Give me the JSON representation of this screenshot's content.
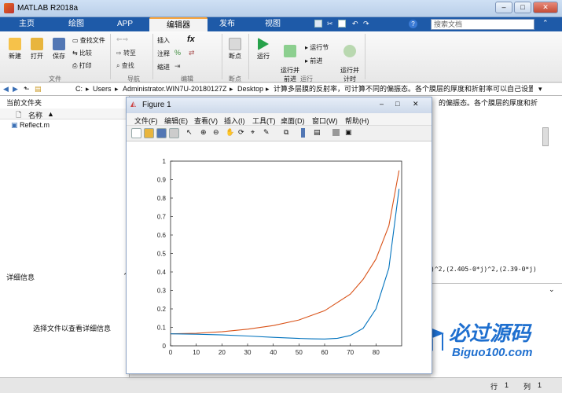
{
  "app": {
    "title": "MATLAB R2018a",
    "search_placeholder": "搜索文档"
  },
  "tabs": [
    {
      "label": "主页"
    },
    {
      "label": "绘图"
    },
    {
      "label": "APP"
    },
    {
      "label": "编辑器"
    },
    {
      "label": "发布"
    },
    {
      "label": "视图"
    }
  ],
  "ribbon": {
    "file": {
      "new": "新建",
      "open": "打开",
      "save": "保存",
      "find_files": "查找文件",
      "compare": "比较",
      "print": "打印",
      "group": "文件"
    },
    "nav": {
      "goto": "转至",
      "find": "查找",
      "group": "导航"
    },
    "edit": {
      "insert": "插入",
      "comment": "注释",
      "indent": "缩进",
      "fx": "fx",
      "group": "编辑"
    },
    "breakpoints": {
      "label": "断点",
      "group": "断点"
    },
    "run": {
      "run": "运行",
      "run_advance": "运行并\n前进",
      "run_section": "运行节",
      "advance": "前进",
      "run_time": "运行并\n计时",
      "group": "运行"
    }
  },
  "address": {
    "parts": [
      "C:",
      "Users",
      "Administrator.WIN7U-20180127Z",
      "Desktop",
      "计算多层膜的反射率，可计算不同的偏振态。各个膜层的厚度和折射率可以自己设置"
    ]
  },
  "current_folder": {
    "title": "当前文件夹",
    "col_name": "名称",
    "col_sort": "▲",
    "files": [
      "Reflect.m"
    ]
  },
  "details": {
    "title": "详细信息",
    "hint": "选择文件以查看详细信息"
  },
  "editor": {
    "snippet": "的偏振态。各个膜层的厚度和折",
    "code": ")^2,(2.405-0*j)^2,(2.39-0*j)"
  },
  "status": {
    "row_label": "行",
    "row": "1",
    "col_label": "列",
    "col": "1"
  },
  "figure": {
    "title": "Figure 1",
    "menu": [
      "文件(F)",
      "编辑(E)",
      "查看(V)",
      "插入(I)",
      "工具(T)",
      "桌面(D)",
      "窗口(W)",
      "帮助(H)"
    ]
  },
  "watermark": {
    "text": "必过源码",
    "url": "Biguo100.com"
  },
  "colors": {
    "series1": "#d95319",
    "series2": "#0072bd",
    "tabbar": "#1e5aa8",
    "accent": "#f7a33c"
  },
  "chart_data": {
    "type": "line",
    "xlim": [
      0,
      90
    ],
    "ylim": [
      0,
      1
    ],
    "xticks": [
      0,
      10,
      20,
      30,
      40,
      50,
      60,
      70,
      80
    ],
    "yticks": [
      0,
      0.1,
      0.2,
      0.3,
      0.4,
      0.5,
      0.6,
      0.7,
      0.8,
      0.9,
      1
    ],
    "grid": false,
    "series": [
      {
        "color": "#d95319",
        "x": [
          0,
          10,
          20,
          30,
          40,
          50,
          60,
          70,
          75,
          80,
          85,
          89
        ],
        "y": [
          0.065,
          0.068,
          0.076,
          0.09,
          0.11,
          0.14,
          0.19,
          0.28,
          0.36,
          0.47,
          0.65,
          0.95
        ]
      },
      {
        "color": "#0072bd",
        "x": [
          0,
          10,
          20,
          30,
          40,
          50,
          55,
          60,
          65,
          70,
          75,
          80,
          85,
          89
        ],
        "y": [
          0.065,
          0.063,
          0.059,
          0.053,
          0.046,
          0.04,
          0.038,
          0.037,
          0.041,
          0.056,
          0.095,
          0.2,
          0.42,
          0.85
        ]
      }
    ]
  }
}
